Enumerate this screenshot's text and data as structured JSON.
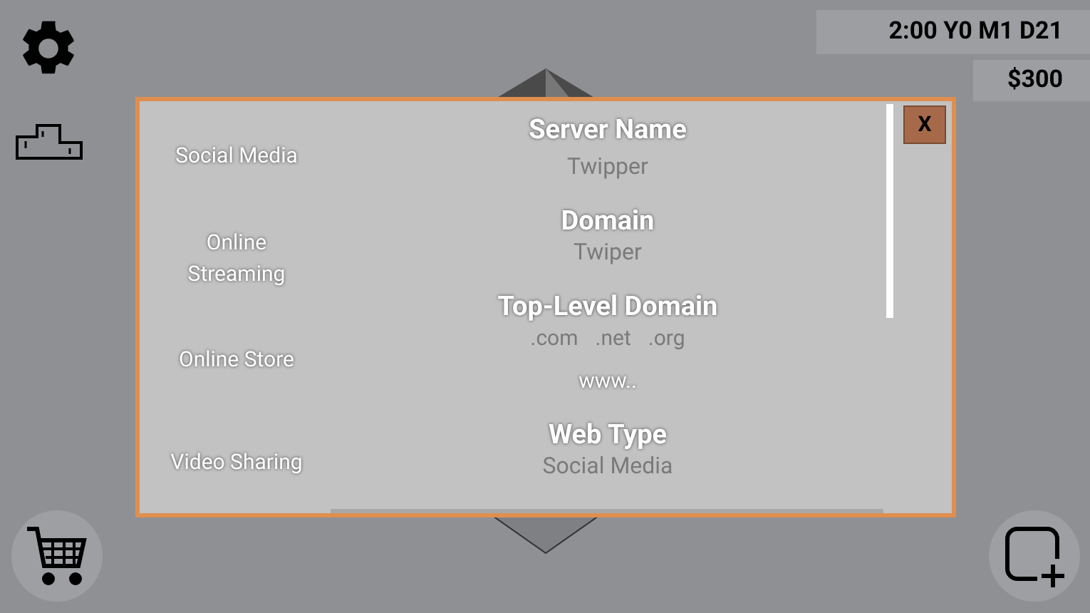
{
  "clock": "2:00 Y0 M1 D21",
  "money": "$300",
  "dialog": {
    "close": "X",
    "categories": [
      "Social Media",
      "Online Streaming",
      "Online Store",
      "Video Sharing"
    ],
    "fields": [
      {
        "kind": "text",
        "label": "Server Name",
        "value": "Twipper"
      },
      {
        "kind": "text",
        "label": "Domain",
        "value": "Twiper"
      },
      {
        "kind": "options",
        "label": "Top-Level Domain",
        "options": [
          ".com",
          ".net",
          ".org"
        ],
        "value": "www.."
      },
      {
        "kind": "text",
        "label": "Web Type",
        "value": "Social Media"
      }
    ]
  }
}
